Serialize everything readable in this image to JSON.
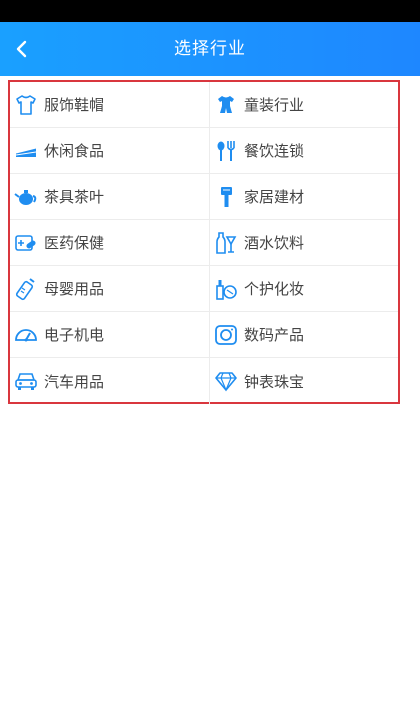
{
  "header": {
    "title": "选择行业",
    "back_icon": "chevron-left-icon"
  },
  "colors": {
    "header_start": "#1aa0ff",
    "header_end": "#1e87ff",
    "icon_blue": "#1f8df0",
    "highlight_border": "#d9363e"
  },
  "industries": [
    {
      "label": "服饰鞋帽",
      "icon": "shirt-icon"
    },
    {
      "label": "童装行业",
      "icon": "kids-clothing-icon"
    },
    {
      "label": "休闲食品",
      "icon": "cake-icon"
    },
    {
      "label": "餐饮连锁",
      "icon": "fork-spoon-icon"
    },
    {
      "label": "茶具茶叶",
      "icon": "teapot-icon"
    },
    {
      "label": "家居建材",
      "icon": "paint-brush-icon"
    },
    {
      "label": "医药保健",
      "icon": "medicine-icon"
    },
    {
      "label": "酒水饮料",
      "icon": "bottle-glass-icon"
    },
    {
      "label": "母婴用品",
      "icon": "baby-bottle-icon"
    },
    {
      "label": "个护化妆",
      "icon": "cosmetics-icon"
    },
    {
      "label": "电子机电",
      "icon": "gauge-icon"
    },
    {
      "label": "数码产品",
      "icon": "camera-icon"
    },
    {
      "label": "汽车用品",
      "icon": "car-icon"
    },
    {
      "label": "钟表珠宝",
      "icon": "diamond-icon"
    }
  ]
}
